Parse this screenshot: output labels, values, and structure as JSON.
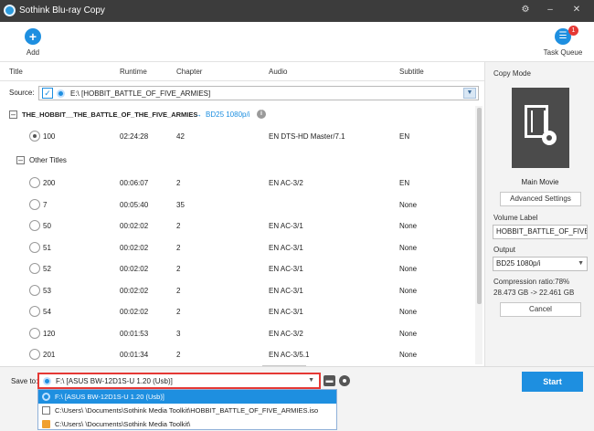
{
  "window": {
    "title": "Sothink Blu-ray Copy",
    "controls": [
      "⚙",
      "–",
      "✕"
    ]
  },
  "toolbar": {
    "add_label": "Add",
    "add_icon": "+",
    "task_label": "Task Queue",
    "task_icon": "☰",
    "task_badge": "1"
  },
  "columns": {
    "title": "Title",
    "runtime": "Runtime",
    "chapter": "Chapter",
    "audio": "Audio",
    "subtitle": "Subtitle"
  },
  "source": {
    "label": "Source:",
    "check": "✓",
    "value": "E:\\ [HOBBIT_BATTLE_OF_FIVE_ARMIES]",
    "dropdown": "▼"
  },
  "main_title": {
    "collapse": "–",
    "name": "THE_HOBBIT__THE_BATTLE_OF_THE_FIVE_ARMIES",
    "arrow": "→",
    "target": "BD25 1080p/i",
    "info": "i"
  },
  "main_row": {
    "title": "100",
    "runtime": "02:24:28",
    "chapter": "42",
    "audio": "EN  DTS-HD Master/7.1",
    "subtitle": "EN"
  },
  "other_titles": {
    "collapse": "–",
    "label": "Other Titles"
  },
  "rows": [
    {
      "title": "200",
      "runtime": "00:06:07",
      "chapter": "2",
      "audio": "EN  AC-3/2",
      "subtitle": "EN"
    },
    {
      "title": "7",
      "runtime": "00:05:40",
      "chapter": "35",
      "audio": "",
      "subtitle": "None"
    },
    {
      "title": "50",
      "runtime": "00:02:02",
      "chapter": "2",
      "audio": "EN  AC-3/1",
      "subtitle": "None"
    },
    {
      "title": "51",
      "runtime": "00:02:02",
      "chapter": "2",
      "audio": "EN  AC-3/1",
      "subtitle": "None"
    },
    {
      "title": "52",
      "runtime": "00:02:02",
      "chapter": "2",
      "audio": "EN  AC-3/1",
      "subtitle": "None"
    },
    {
      "title": "53",
      "runtime": "00:02:02",
      "chapter": "2",
      "audio": "EN  AC-3/1",
      "subtitle": "None"
    },
    {
      "title": "54",
      "runtime": "00:02:02",
      "chapter": "2",
      "audio": "EN  AC-3/1",
      "subtitle": "None"
    },
    {
      "title": "120",
      "runtime": "00:01:53",
      "chapter": "3",
      "audio": "EN  AC-3/2",
      "subtitle": "None"
    },
    {
      "title": "201",
      "runtime": "00:01:34",
      "chapter": "2",
      "audio": "EN  AC-3/5.1",
      "subtitle": "None"
    }
  ],
  "right_panel": {
    "copy_mode": "Copy Mode",
    "mode_name": "Main Movie",
    "advanced": "Advanced Settings",
    "volume_label": "Volume Label",
    "volume_value": "HOBBIT_BATTLE_OF_FIVE_",
    "output_label": "Output",
    "output_value": "BD25 1080p/i",
    "output_caret": "▼",
    "ratio": "Compression ratio:78%",
    "sizes": "28.473 GB -> 22.461 GB",
    "cancel": "Cancel"
  },
  "bottom": {
    "save_label": "Save to:",
    "save_value": "F:\\ [ASUS BW-12D1S-U 1.20 (Usb)]",
    "save_caret": "▼",
    "folder_icon": "▬",
    "start": "Start"
  },
  "dropdown_items": [
    "F:\\ [ASUS BW-12D1S-U 1.20 (Usb)]",
    "C:\\Users\\            \\Documents\\Sothink Media Toolkit\\HOBBIT_BATTLE_OF_FIVE_ARMIES.iso",
    "C:\\Users\\            \\Documents\\Sothink Media Toolkit\\"
  ],
  "colors": {
    "accent": "#1e8fe0",
    "titlebar": "#3c3c3c",
    "highlight": "#e53935",
    "panel": "#f3f3f3"
  }
}
